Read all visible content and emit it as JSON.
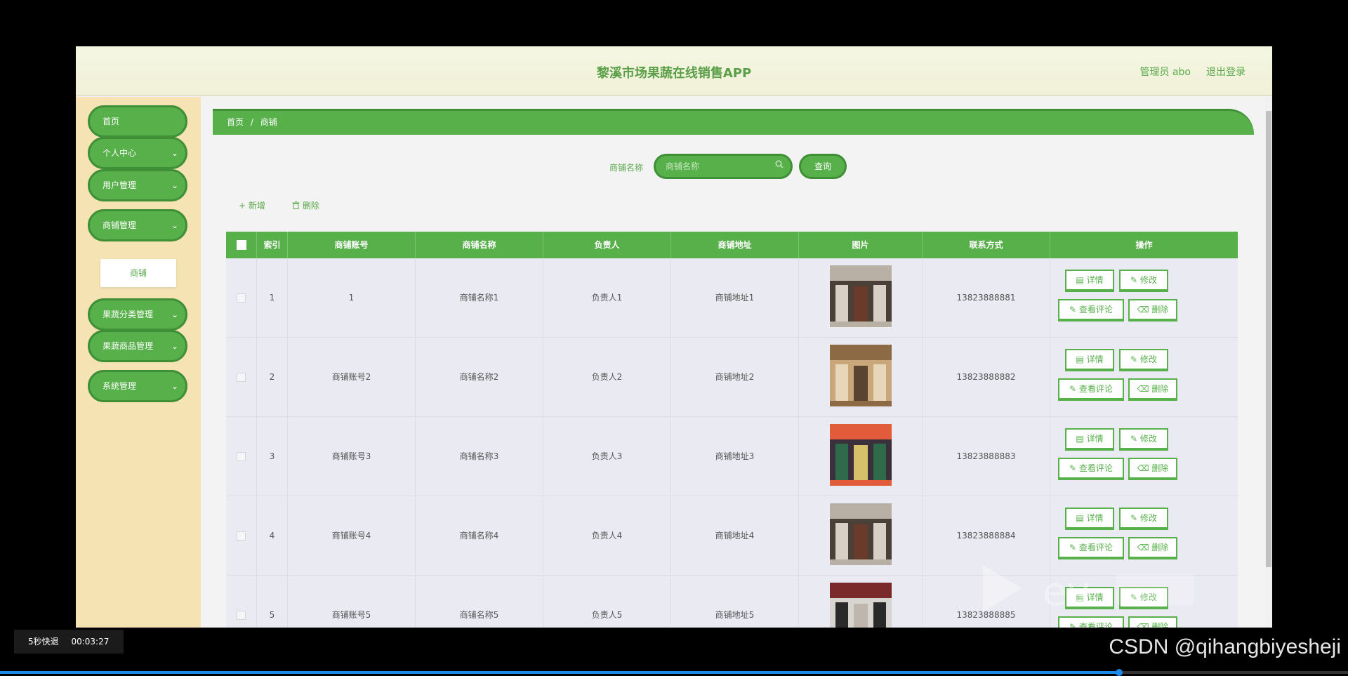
{
  "app": {
    "title": "黎溪市场果蔬在线销售APP",
    "admin": "管理员 abo",
    "logout": "退出登录"
  },
  "sidebar": {
    "items": [
      {
        "label": "首页"
      },
      {
        "label": "个人中心"
      },
      {
        "label": "用户管理"
      },
      {
        "label": "商铺管理"
      },
      {
        "label": "果蔬分类管理"
      },
      {
        "label": "果蔬商品管理"
      },
      {
        "label": "系统管理"
      }
    ],
    "sub_item": "商铺",
    "chevron": "⌄"
  },
  "breadcrumb": {
    "home": "首页",
    "sep": "/",
    "current": "商铺"
  },
  "search": {
    "label": "商铺名称",
    "placeholder": "商铺名称",
    "query_label": "查询"
  },
  "toolbar": {
    "add_label": "+ 新增",
    "delete_label": "删除"
  },
  "table": {
    "headers": [
      "索引",
      "商铺账号",
      "商铺名称",
      "负责人",
      "商铺地址",
      "图片",
      "联系方式",
      "操作"
    ],
    "rows": [
      {
        "index": "1",
        "account": "1",
        "name": "商铺名称1",
        "manager": "负责人1",
        "address": "商铺地址1",
        "phone": "13823888881"
      },
      {
        "index": "2",
        "account": "商铺账号2",
        "name": "商铺名称2",
        "manager": "负责人2",
        "address": "商铺地址2",
        "phone": "13823888882"
      },
      {
        "index": "3",
        "account": "商铺账号3",
        "name": "商铺名称3",
        "manager": "负责人3",
        "address": "商铺地址3",
        "phone": "13823888883"
      },
      {
        "index": "4",
        "account": "商铺账号4",
        "name": "商铺名称4",
        "manager": "负责人4",
        "address": "商铺地址4",
        "phone": "13823888884"
      },
      {
        "index": "5",
        "account": "商铺账号5",
        "name": "商铺名称5",
        "manager": "负责人5",
        "address": "商铺地址5",
        "phone": "13823888885"
      }
    ],
    "actions": {
      "detail": "详情",
      "edit": "修改",
      "reviews": "查看评论",
      "delete": "删除"
    }
  },
  "overlay": {
    "skip_text": "5秒快退",
    "timestamp": "00:03:27",
    "credit": "CSDN @qihangbiyesheji",
    "progress": 0.83
  },
  "colors": {
    "primary": "#57b04a",
    "primary_dark": "#3f8f37",
    "sidebar_bg": "#f5e3b4",
    "header_bg": "#f4f7e2"
  }
}
